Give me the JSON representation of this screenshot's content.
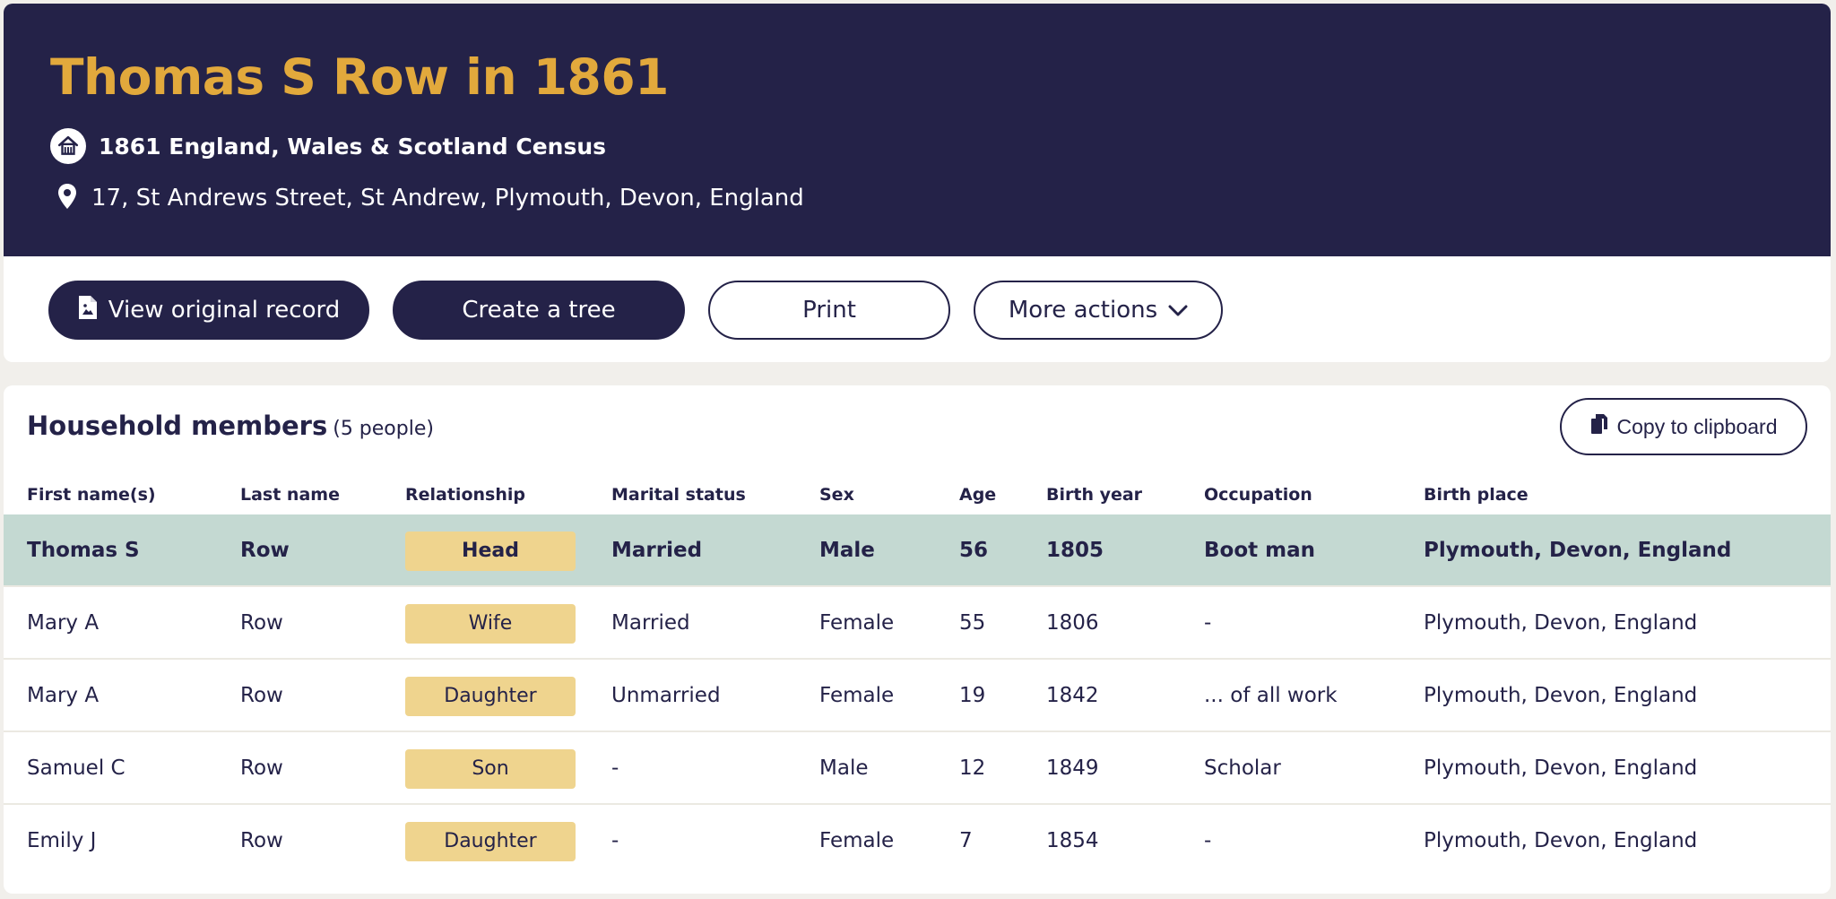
{
  "header": {
    "title": "Thomas S Row in 1861",
    "census_name": "1861 England, Wales & Scotland Census",
    "address": "17, St Andrews Street, St Andrew, Plymouth, Devon, England",
    "icons": {
      "census": "house-icon",
      "address": "map-pin-icon"
    }
  },
  "actions": {
    "view_original": "View original record",
    "create_tree": "Create a tree",
    "print": "Print",
    "more_actions": "More actions"
  },
  "household": {
    "title": "Household members",
    "count": "(5 people)",
    "copy_label": "Copy to clipboard",
    "columns": [
      "First name(s)",
      "Last name",
      "Relationship",
      "Marital status",
      "Sex",
      "Age",
      "Birth year",
      "Occupation",
      "Birth place"
    ],
    "rows": [
      {
        "first": "Thomas S",
        "last": "Row",
        "relationship": "Head",
        "marital": "Married",
        "sex": "Male",
        "age": "56",
        "birth_year": "1805",
        "occupation": "Boot man",
        "birth_place": "Plymouth, Devon, England"
      },
      {
        "first": "Mary A",
        "last": "Row",
        "relationship": "Wife",
        "marital": "Married",
        "sex": "Female",
        "age": "55",
        "birth_year": "1806",
        "occupation": "-",
        "birth_place": "Plymouth, Devon, England"
      },
      {
        "first": "Mary A",
        "last": "Row",
        "relationship": "Daughter",
        "marital": "Unmarried",
        "sex": "Female",
        "age": "19",
        "birth_year": "1842",
        "occupation": "... of all work",
        "birth_place": "Plymouth, Devon, England"
      },
      {
        "first": "Samuel C",
        "last": "Row",
        "relationship": "Son",
        "marital": "-",
        "sex": "Male",
        "age": "12",
        "birth_year": "1849",
        "occupation": "Scholar",
        "birth_place": "Plymouth, Devon, England"
      },
      {
        "first": "Emily J",
        "last": "Row",
        "relationship": "Daughter",
        "marital": "-",
        "sex": "Female",
        "age": "7",
        "birth_year": "1854",
        "occupation": "-",
        "birth_place": "Plymouth, Devon, England"
      }
    ]
  },
  "colors": {
    "navy": "#242248",
    "gold": "#e2a93c",
    "badge": "#efd48e",
    "highlight_row": "#c4d9d2",
    "page_bg": "#f1efeb"
  }
}
